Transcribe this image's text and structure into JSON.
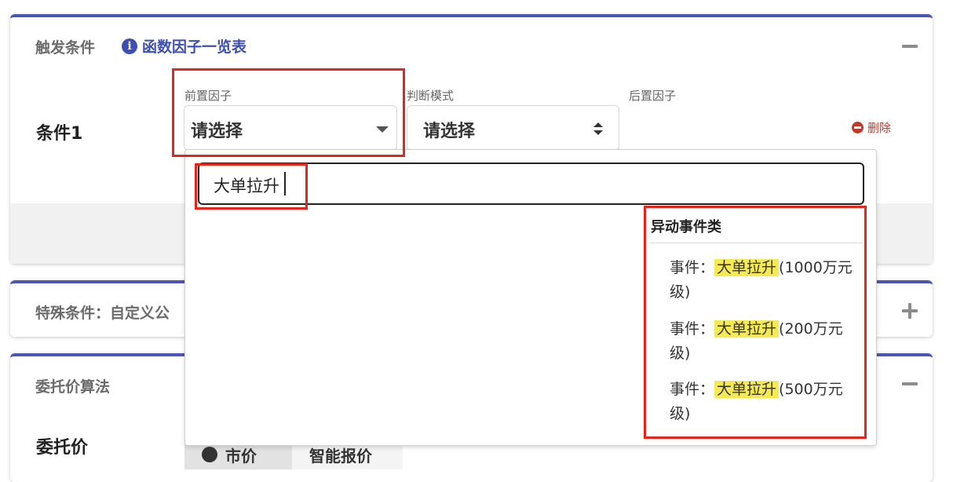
{
  "trigger_card": {
    "title": "触发条件",
    "info_link": "函数因子一览表",
    "condition_label": "条件1",
    "pre_factor": {
      "label": "前置因子",
      "value": "请选择"
    },
    "judge_mode": {
      "label": "判断模式",
      "value": "请选择"
    },
    "post_factor": {
      "label": "后置因子"
    },
    "delete_label": "删除"
  },
  "special_card": {
    "title": "特殊条件：自定义公"
  },
  "entrust_card": {
    "title": "委托价算法",
    "price_label": "委托价",
    "btn_1": "市价",
    "btn_2": "智能报价"
  },
  "dropdown": {
    "search_value": "大单拉升",
    "group_title": "异动事件类",
    "options": [
      {
        "prefix": "事件：",
        "match": "大单拉升",
        "suffix": "(1000万元级)"
      },
      {
        "prefix": "事件：",
        "match": "大单拉升",
        "suffix": "(200万元级)"
      },
      {
        "prefix": "事件：",
        "match": "大单拉升",
        "suffix": "(500万元级)"
      }
    ]
  },
  "icons": {
    "info": "info-circle-icon",
    "delete": "minus-circle-icon",
    "collapse": "minus-icon",
    "expand": "plus-icon",
    "select_caret": "caret-down-icon",
    "select_updown": "sort-updown-icon"
  },
  "colors": {
    "card_top_border": "#4a55b4",
    "link": "#3d4fb0",
    "delete": "#c0392b",
    "highlight": "#f5ea54",
    "annotation_box": "#e3261b"
  }
}
